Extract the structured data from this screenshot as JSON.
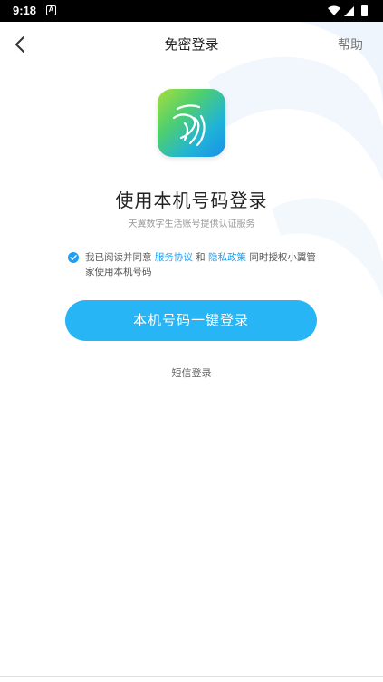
{
  "status_bar": {
    "time": "9:18",
    "notification_badge": "A",
    "icons": [
      "wifi-icon",
      "cellular-signal-icon",
      "battery-icon"
    ]
  },
  "nav": {
    "title": "免密登录",
    "help_label": "帮助"
  },
  "logo": {
    "icon": "tianyi-app-logo"
  },
  "main": {
    "title": "使用本机号码登录",
    "subtitle": "天翼数字生活账号提供认证服务"
  },
  "agreement": {
    "prefix": "我已阅读并同意 ",
    "service_link": "服务协议",
    "and": " 和 ",
    "privacy_link": "隐私政策",
    "suffix": " 同时授权小翼管家使用本机号码",
    "checked": true
  },
  "login_button": {
    "label": "本机号码一键登录"
  },
  "sms_login": {
    "label": "短信登录"
  },
  "colors": {
    "accent": "#28b5f5",
    "link": "#1e9ff2"
  }
}
